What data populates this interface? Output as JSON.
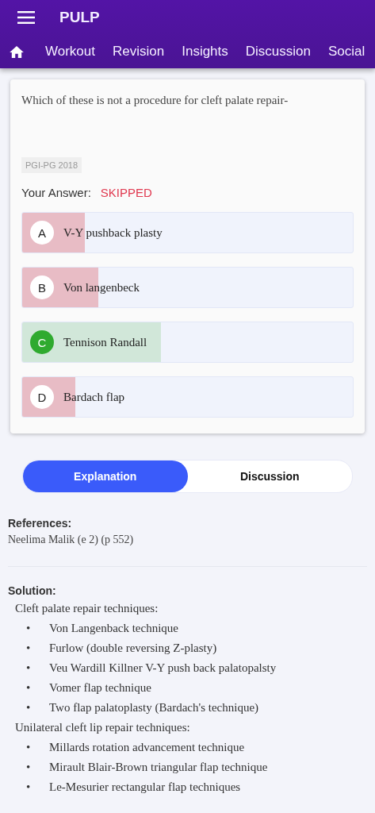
{
  "app_bar": {
    "title": "PULP"
  },
  "nav_tabs": [
    {
      "label": "Workout",
      "selected": false
    },
    {
      "label": "Revision",
      "selected": false
    },
    {
      "label": "Insights",
      "selected": false
    },
    {
      "label": "Discussion",
      "selected": false
    },
    {
      "label": "Social",
      "selected": false
    }
  ],
  "question": {
    "text": "Which of these is not a procedure for cleft palate repair-",
    "tag": "PGI-PG 2018",
    "answer_label": "Your Answer:",
    "answer_value": "SKIPPED",
    "options": [
      {
        "letter": "A",
        "text": "V-Y pushback plasty",
        "level": 0.19,
        "correct": false
      },
      {
        "letter": "B",
        "text": "Von langenbeck",
        "level": 0.23,
        "correct": false
      },
      {
        "letter": "C",
        "text": "Tennison Randall",
        "level": 0.42,
        "correct": true
      },
      {
        "letter": "D",
        "text": "Bardach flap",
        "level": 0.16,
        "correct": false
      }
    ]
  },
  "toggle": [
    {
      "label": "Explanation",
      "selected": true
    },
    {
      "label": "Discussion",
      "selected": false
    }
  ],
  "references": {
    "heading": "References:",
    "text": "Neelima Malik (e 2) (p 552)"
  },
  "solution": {
    "heading": "Solution:",
    "sections": [
      {
        "title": "Cleft palate repair techniques:",
        "items": [
          {
            "bullet": "•",
            "text": "Von Langenback technique"
          },
          {
            "bullet": "•",
            "text": "Furlow (double reversing Z-plasty)"
          },
          {
            "bullet": "•",
            "text": "Veu Wardill Killner V-Y push back palatopalsty"
          },
          {
            "bullet": "•",
            "text": "Vomer flap technique"
          },
          {
            "bullet": "•",
            "text": "Two flap palatoplasty (Bardach's technique)"
          }
        ]
      },
      {
        "title": "Unilateral cleft lip repair techniques:",
        "items": [
          {
            "bullet": "•",
            "text": "Millards rotation advancement technique"
          },
          {
            "bullet": "•",
            "text": "Mirault Blair-Brown triangular flap technique"
          },
          {
            "bullet": "•",
            "text": "Le-Mesurier rectangular flap techniques"
          }
        ]
      }
    ]
  }
}
